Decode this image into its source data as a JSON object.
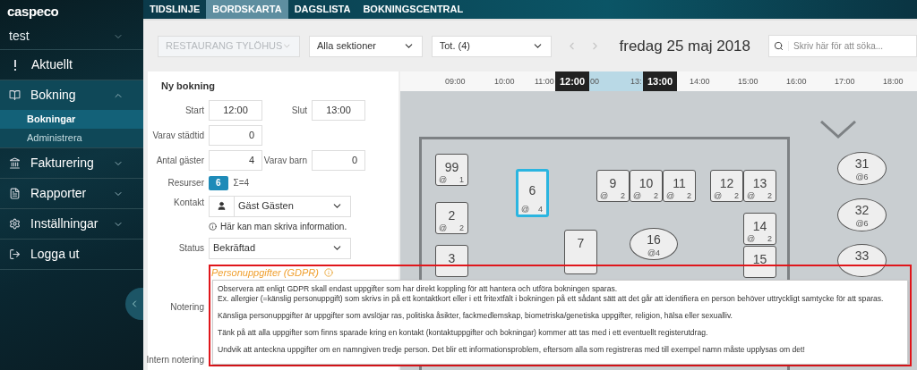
{
  "sidebar": {
    "logo": "caspeco",
    "account": "test",
    "items": [
      {
        "label": "Aktuellt",
        "kind": "link"
      },
      {
        "label": "Bokning",
        "kind": "group",
        "expanded": true,
        "children": [
          {
            "label": "Bokningar",
            "selected": true
          },
          {
            "label": "Administrera",
            "selected": false
          }
        ]
      },
      {
        "label": "Fakturering",
        "kind": "group",
        "expanded": false
      },
      {
        "label": "Rapporter",
        "kind": "group",
        "expanded": false
      },
      {
        "label": "Inställningar",
        "kind": "group",
        "expanded": false
      },
      {
        "label": "Logga ut",
        "kind": "link"
      }
    ]
  },
  "tabs": [
    {
      "label": "TIDSLINJE",
      "selected": false
    },
    {
      "label": "BORDSKARTA",
      "selected": true
    },
    {
      "label": "DAGSLISTA",
      "selected": false
    },
    {
      "label": "BOKNINGSCENTRAL",
      "selected": false
    }
  ],
  "toolbar": {
    "restaurant": {
      "value": "RESTAURANG TYLÖHUS",
      "disabled": true
    },
    "section": {
      "value": "Alla sektioner",
      "disabled": false
    },
    "total": {
      "value": "Tot. (4)",
      "disabled": false
    },
    "date": "fredag 25 maj 2018",
    "search": {
      "placeholder": "Skriv här för att söka..."
    }
  },
  "form": {
    "title": "Ny bokning",
    "start": {
      "label": "Start",
      "value": "12:00"
    },
    "end": {
      "label": "Slut",
      "value": "13:00"
    },
    "cleaning": {
      "label": "Varav städtid",
      "value": "0"
    },
    "guests": {
      "label": "Antal gäster",
      "value": "4"
    },
    "children": {
      "label": "Varav barn",
      "value": "0"
    },
    "resources": {
      "label": "Resurser",
      "badge": "6",
      "sum": "Σ=4"
    },
    "contact": {
      "label": "Kontakt",
      "value": "Gäst Gästen",
      "hint": "Här kan man skriva information."
    },
    "status": {
      "label": "Status",
      "value": "Bekräftad"
    },
    "note": {
      "label": "Notering"
    },
    "internal_note": {
      "label": "Intern notering"
    }
  },
  "timeline": {
    "ticks": [
      "09:00",
      "10:00",
      "11:00",
      "14:00",
      "15:00",
      "16:00",
      "17:00",
      "18:00"
    ],
    "selection": {
      "start": "12:00",
      "end": "13:00",
      "inner": [
        "00",
        "13:"
      ]
    }
  },
  "tables": [
    {
      "number": "99",
      "kind": "rect",
      "seat_icon": "@",
      "seats": "1",
      "selected": false
    },
    {
      "number": "2",
      "kind": "rect",
      "seat_icon": "@",
      "seats": "2",
      "selected": false
    },
    {
      "number": "3",
      "kind": "rect",
      "selected": false
    },
    {
      "number": "6",
      "kind": "rect",
      "seat_icon": "@",
      "seats": "4",
      "selected": true
    },
    {
      "number": "9",
      "kind": "rect",
      "seat_icon": "@",
      "seats": "2",
      "selected": false
    },
    {
      "number": "10",
      "kind": "rect",
      "seat_icon": "@",
      "seats": "2",
      "selected": false
    },
    {
      "number": "11",
      "kind": "rect",
      "seat_icon": "@",
      "seats": "2",
      "selected": false
    },
    {
      "number": "12",
      "kind": "rect",
      "seat_icon": "@",
      "seats": "2",
      "selected": false
    },
    {
      "number": "13",
      "kind": "rect",
      "seat_icon": "@",
      "seats": "2",
      "selected": false
    },
    {
      "number": "14",
      "kind": "rect",
      "seat_icon": "@",
      "seats": "2",
      "selected": false
    },
    {
      "number": "15",
      "kind": "rect",
      "selected": false
    },
    {
      "number": "7",
      "kind": "rect",
      "selected": false
    },
    {
      "number": "16",
      "kind": "round",
      "seats": "@4",
      "selected": false
    },
    {
      "number": "31",
      "kind": "round",
      "seats": "@6",
      "selected": false
    },
    {
      "number": "32",
      "kind": "round",
      "seats": "@6",
      "selected": false
    },
    {
      "number": "33",
      "kind": "round",
      "selected": false
    }
  ],
  "gdpr": {
    "title": "Personuppgifter (GDPR)",
    "paragraphs": [
      [
        "Observera att enligt GDPR skall endast uppgifter som har direkt koppling för att hantera och utföra bokningen sparas.",
        "Ex. allergier (=känslig personuppgift) som skrivs in på ett kontaktkort eller i ett fritextfält i bokningen på ett sådant sätt att det går att identifiera en person behöver uttryckligt samtycke för att sparas."
      ],
      [
        "Känsliga personuppgifter är uppgifter som avslöjar ras, politiska åsikter, fackmedlemskap, biometriska/genetiska uppgifter, religion, hälsa eller sexualliv."
      ],
      [
        "Tänk på att alla uppgifter som finns sparade kring en kontakt (kontaktuppgifter och bokningar) kommer att tas med i ett eventuellt registerutdrag."
      ],
      [
        "Undvik att anteckna uppgifter om en namngiven tredje person. Det blir ett informationsproblem, eftersom alla som registreras med till exempel namn måste upplysas om det!"
      ]
    ]
  }
}
